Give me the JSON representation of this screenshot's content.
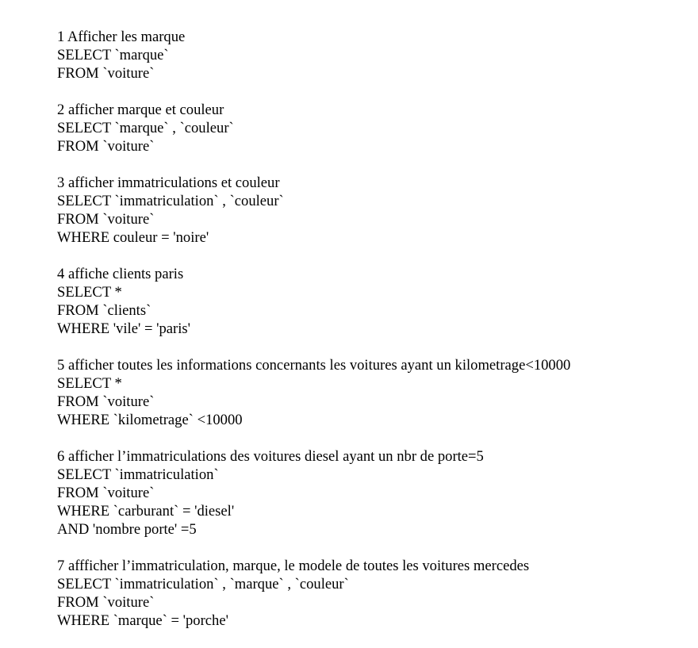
{
  "document": {
    "blocks": [
      {
        "heading": "1 Afficher les marque",
        "lines": [
          "SELECT `marque`",
          "FROM `voiture`"
        ]
      },
      {
        "heading": "2 afficher marque et couleur",
        "lines": [
          "SELECT `marque` , `couleur`",
          "FROM `voiture`"
        ]
      },
      {
        "heading": "3 afficher immatriculations et couleur",
        "lines": [
          "SELECT `immatriculation` , `couleur`",
          "FROM `voiture`",
          "WHERE couleur = 'noire'"
        ]
      },
      {
        "heading": "4 affiche clients paris",
        "lines": [
          "SELECT *",
          "FROM `clients`",
          "WHERE 'vile' = 'paris'"
        ]
      },
      {
        "heading": "5 afficher toutes les informations concernants les voitures ayant un kilometrage<10000",
        "lines": [
          "SELECT *",
          "FROM `voiture`",
          "WHERE `kilometrage` <10000"
        ]
      },
      {
        "heading": "6 afficher l’immatriculations des voitures diesel ayant un nbr de porte=5",
        "lines": [
          "SELECT `immatriculation`",
          "FROM `voiture`",
          "WHERE `carburant` = 'diesel'",
          "AND 'nombre porte' =5"
        ]
      },
      {
        "heading": "7 affficher l’immatriculation, marque, le modele de toutes les voitures mercedes",
        "lines": [
          "SELECT `immatriculation` , `marque` , `couleur`",
          "FROM `voiture`",
          "WHERE `marque` = 'porche'"
        ]
      }
    ]
  }
}
